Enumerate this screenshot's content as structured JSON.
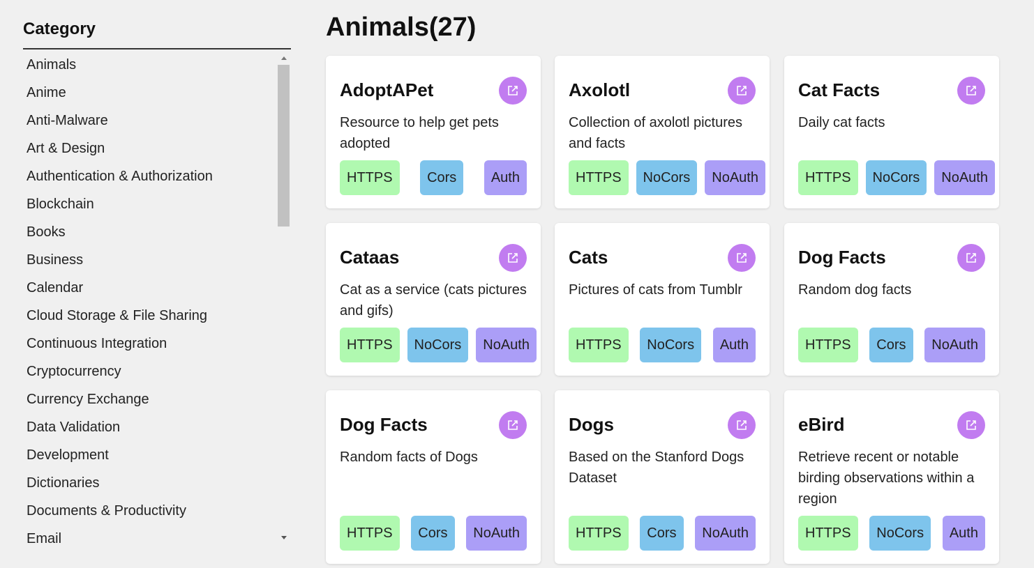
{
  "sidebar": {
    "title": "Category",
    "items": [
      "Animals",
      "Anime",
      "Anti-Malware",
      "Art & Design",
      "Authentication & Authorization",
      "Blockchain",
      "Books",
      "Business",
      "Calendar",
      "Cloud Storage & File Sharing",
      "Continuous Integration",
      "Cryptocurrency",
      "Currency Exchange",
      "Data Validation",
      "Development",
      "Dictionaries",
      "Documents & Productivity",
      "Email"
    ]
  },
  "main": {
    "title": "Animals(27)",
    "cards": [
      {
        "name": "AdoptAPet",
        "desc": "Resource to help get pets adopted",
        "https": "HTTPS",
        "cors": "Cors",
        "auth": "Auth"
      },
      {
        "name": "Axolotl",
        "desc": "Collection of axolotl pictures and facts",
        "https": "HTTPS",
        "cors": "NoCors",
        "auth": "NoAuth"
      },
      {
        "name": "Cat Facts",
        "desc": "Daily cat facts",
        "https": "HTTPS",
        "cors": "NoCors",
        "auth": "NoAuth"
      },
      {
        "name": "Cataas",
        "desc": "Cat as a service (cats pictures and gifs)",
        "https": "HTTPS",
        "cors": "NoCors",
        "auth": "NoAuth"
      },
      {
        "name": "Cats",
        "desc": "Pictures of cats from Tumblr",
        "https": "HTTPS",
        "cors": "NoCors",
        "auth": "Auth"
      },
      {
        "name": "Dog Facts",
        "desc": "Random dog facts",
        "https": "HTTPS",
        "cors": "Cors",
        "auth": "NoAuth"
      },
      {
        "name": "Dog Facts",
        "desc": "Random facts of Dogs",
        "https": "HTTPS",
        "cors": "Cors",
        "auth": "NoAuth"
      },
      {
        "name": "Dogs",
        "desc": "Based on the Stanford Dogs Dataset",
        "https": "HTTPS",
        "cors": "Cors",
        "auth": "NoAuth"
      },
      {
        "name": "eBird",
        "desc": "Retrieve recent or notable birding observations within a region",
        "https": "HTTPS",
        "cors": "NoCors",
        "auth": "Auth"
      }
    ]
  },
  "icons": {
    "card_link": "external-link-icon",
    "scroll_up": "arrow-up-icon",
    "scroll_down": "arrow-down-icon"
  },
  "colors": {
    "link_button": "#c17cf0",
    "https_tag": "#b0f9b0",
    "cors_tag": "#7ec4ec",
    "auth_tag": "#ab9ef7",
    "background": "#f0f0f0"
  }
}
